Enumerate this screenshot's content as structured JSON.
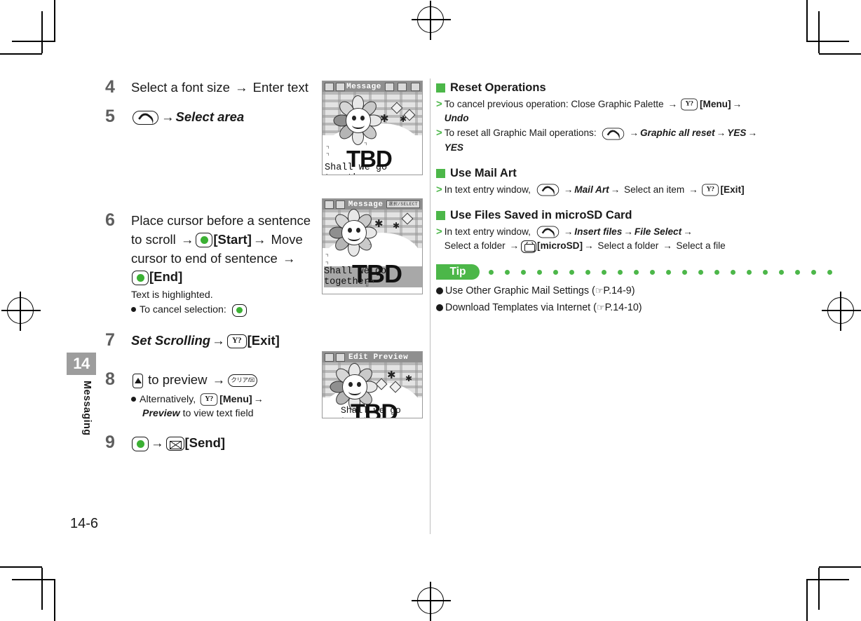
{
  "page": {
    "folio": "14-6",
    "chapter_number": "14",
    "chapter_name": "Messaging"
  },
  "steps": [
    {
      "num": "4",
      "parts": [
        {
          "t": "text",
          "v": "Select a font size "
        },
        {
          "t": "arrow",
          "v": "→"
        },
        {
          "t": "text",
          "v": " Enter text"
        }
      ]
    },
    {
      "num": "5",
      "parts": [
        {
          "t": "key",
          "v": "call-key"
        },
        {
          "t": "arrow",
          "v": "→"
        },
        {
          "t": "italic-bold",
          "v": "Select area"
        }
      ]
    },
    {
      "num": "6",
      "parts": [
        {
          "t": "text",
          "v": "Place cursor before a sentence to scroll "
        },
        {
          "t": "arrow",
          "v": "→"
        },
        {
          "t": "key",
          "v": "center-key"
        },
        {
          "t": "bold",
          "v": "[Start]"
        },
        {
          "t": "arrow",
          "v": "→"
        },
        {
          "t": "text",
          "v": " Move cursor to end of sentence "
        },
        {
          "t": "arrow",
          "v": "→"
        },
        {
          "t": "key",
          "v": "center-key"
        },
        {
          "t": "bold",
          "v": "[End]"
        }
      ],
      "note": "Text is highlighted.",
      "bullet": "To cancel selection:"
    },
    {
      "num": "7",
      "parts": [
        {
          "t": "italic-bold",
          "v": "Set Scrolling"
        },
        {
          "t": "arrow",
          "v": "→"
        },
        {
          "t": "key",
          "v": "yahoo-key"
        },
        {
          "t": "bold",
          "v": "[Exit]"
        }
      ]
    },
    {
      "num": "8",
      "parts": [
        {
          "t": "key",
          "v": "up-key"
        },
        {
          "t": "text",
          "v": " to preview "
        },
        {
          "t": "arrow",
          "v": "→"
        },
        {
          "t": "key",
          "v": "clear-key"
        }
      ],
      "bullet_rich": [
        {
          "t": "text",
          "v": "Alternatively, "
        },
        {
          "t": "key",
          "v": "yahoo-key"
        },
        {
          "t": "bold",
          "v": "[Menu]"
        },
        {
          "t": "arrow",
          "v": "→"
        },
        {
          "t": "italic-bold",
          "v": "Preview"
        },
        {
          "t": "text",
          "v": " to view text field"
        }
      ]
    },
    {
      "num": "9",
      "parts": [
        {
          "t": "key",
          "v": "center-key"
        },
        {
          "t": "arrow",
          "v": "→"
        },
        {
          "t": "key",
          "v": "mail-key"
        },
        {
          "t": "bold",
          "v": "[Send]"
        }
      ]
    }
  ],
  "step_labels": {
    "clear_key_text": "クリア/☒",
    "yahoo_key_text": "Y?"
  },
  "right_column": {
    "sections": [
      {
        "heading": "Reset Operations",
        "items": [
          {
            "parts": [
              {
                "t": "text",
                "v": "To cancel previous operation: Close Graphic Palette "
              },
              {
                "t": "arrow",
                "v": "→"
              },
              {
                "t": "key",
                "v": "yahoo-key"
              },
              {
                "t": "bold",
                "v": "[Menu]"
              },
              {
                "t": "arrow",
                "v": "→"
              },
              {
                "t": "italic-bold",
                "v": "Undo"
              }
            ]
          },
          {
            "parts": [
              {
                "t": "text",
                "v": "To reset all Graphic Mail operations: "
              },
              {
                "t": "key",
                "v": "call-key"
              },
              {
                "t": "arrow",
                "v": "→"
              },
              {
                "t": "italic-bold",
                "v": "Graphic all reset"
              },
              {
                "t": "arrow",
                "v": "→"
              },
              {
                "t": "italic-bold",
                "v": "YES"
              },
              {
                "t": "arrow",
                "v": "→"
              },
              {
                "t": "italic-bold",
                "v": "YES"
              }
            ]
          }
        ]
      },
      {
        "heading": "Use Mail Art",
        "items": [
          {
            "parts": [
              {
                "t": "text",
                "v": "In text entry window, "
              },
              {
                "t": "key",
                "v": "call-key"
              },
              {
                "t": "arrow",
                "v": "→"
              },
              {
                "t": "italic-bold",
                "v": "Mail Art"
              },
              {
                "t": "arrow",
                "v": "→"
              },
              {
                "t": "text",
                "v": " Select an item "
              },
              {
                "t": "arrow",
                "v": "→"
              },
              {
                "t": "key",
                "v": "yahoo-key"
              },
              {
                "t": "bold",
                "v": "[Exit]"
              }
            ]
          }
        ]
      },
      {
        "heading": "Use Files Saved in microSD Card",
        "items": [
          {
            "parts": [
              {
                "t": "text",
                "v": "In text entry window, "
              },
              {
                "t": "key",
                "v": "call-key"
              },
              {
                "t": "arrow",
                "v": "→"
              },
              {
                "t": "italic-bold",
                "v": "Insert files"
              },
              {
                "t": "arrow",
                "v": "→"
              },
              {
                "t": "italic-bold",
                "v": "File Select"
              },
              {
                "t": "arrow",
                "v": "→"
              },
              {
                "t": "text",
                "v": " Select a folder "
              },
              {
                "t": "arrow",
                "v": "→"
              },
              {
                "t": "key",
                "v": "microsd-key"
              },
              {
                "t": "bold",
                "v": "[microSD]"
              },
              {
                "t": "arrow",
                "v": "→"
              },
              {
                "t": "text",
                "v": " Select a folder "
              },
              {
                "t": "arrow",
                "v": "→"
              },
              {
                "t": "text",
                "v": " Select a file"
              }
            ]
          }
        ]
      }
    ],
    "tip": {
      "badge": "Tip",
      "dot_count": 22,
      "items": [
        {
          "label": "Use Other Graphic Mail Settings",
          "ref": "P.14-9"
        },
        {
          "label": "Download Templates via Internet",
          "ref": "P.14-10"
        }
      ]
    }
  },
  "screenshots": [
    {
      "name": "message-compose",
      "title": "Message",
      "body_text": "Shall we go together",
      "overlay": "TBD",
      "right_tags": [
        "A",
        "icon"
      ]
    },
    {
      "name": "message-select-area",
      "title": "Message",
      "body_text": "Shall we go together",
      "overlay": "TBD",
      "right_tags": [
        "選択/SELECT"
      ]
    },
    {
      "name": "edit-preview",
      "title": "Edit Preview",
      "body_text": "Shall we go together",
      "overlay": "TBD",
      "right_tags": []
    }
  ],
  "colors": {
    "accent_green": "#4cb749",
    "key_green": "#3bb033",
    "step_number_gray": "#5e5e5e",
    "chapter_tab_gray": "#9d9d9d"
  }
}
